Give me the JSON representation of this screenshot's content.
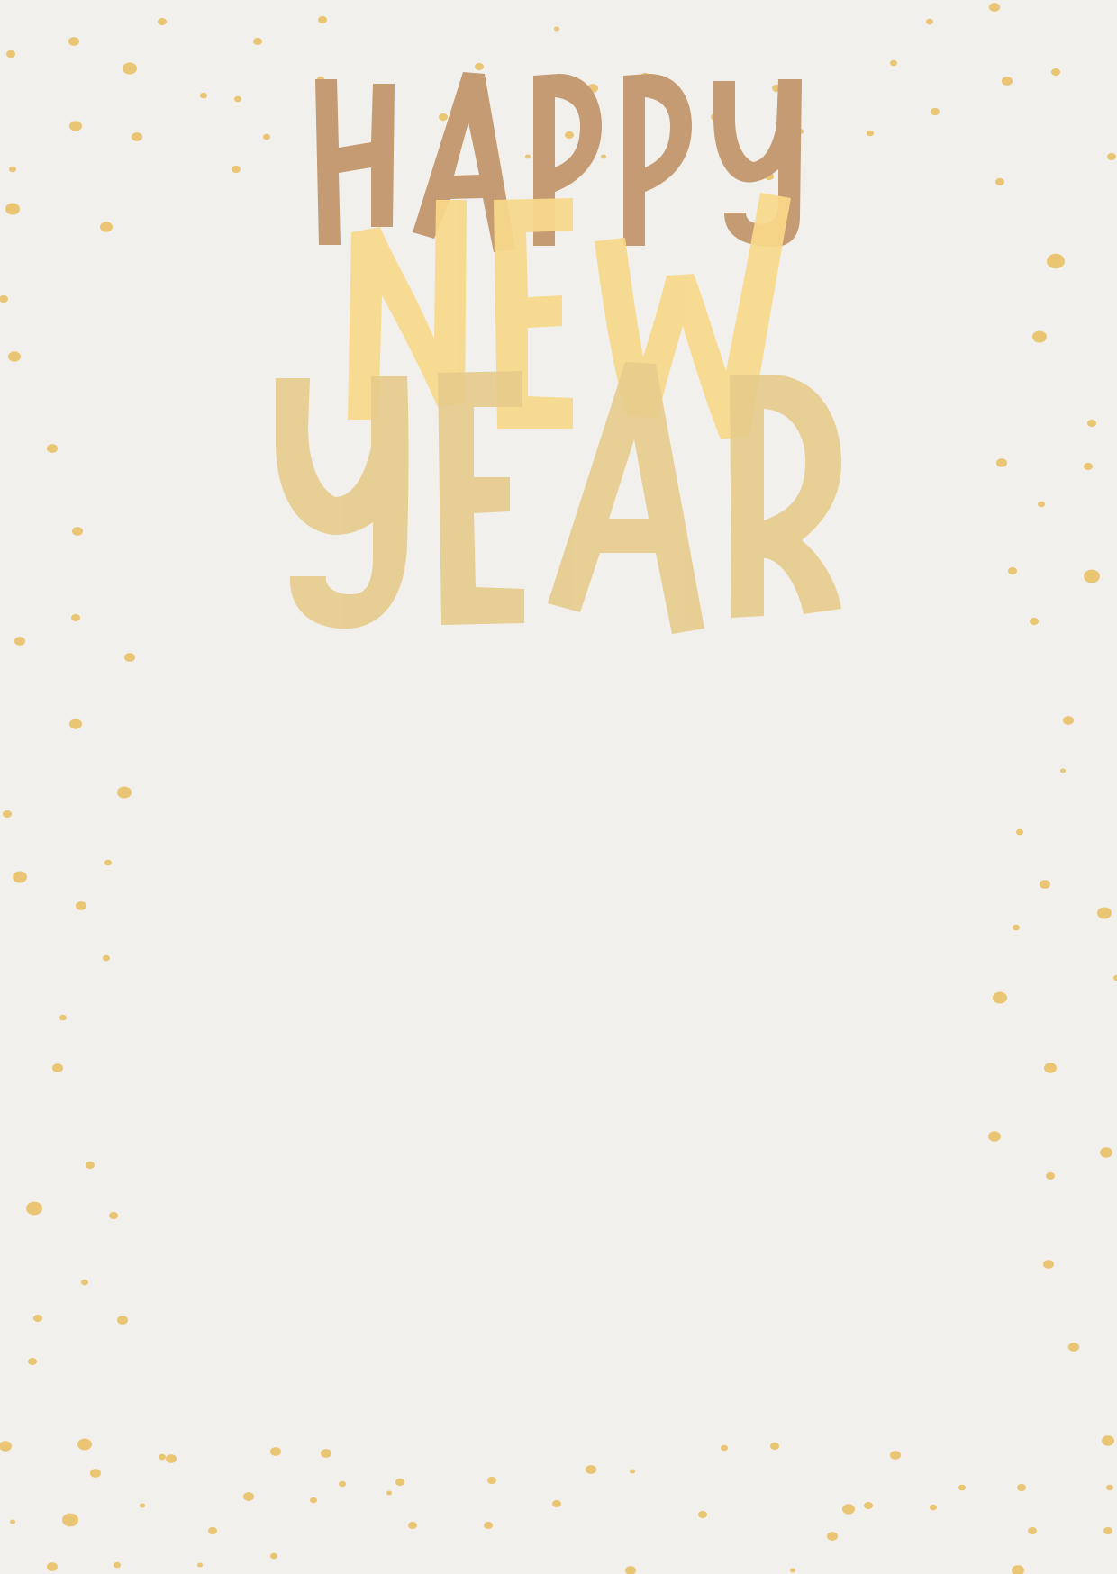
{
  "card": {
    "line1": "HAPPY",
    "line2": "NEW",
    "line3": "YEAR"
  },
  "colors": {
    "background": "#f2f0ec",
    "happy": "#c49b72",
    "new": "#f8d98a",
    "year": "#e6cb8c",
    "confetti": "#e9c574"
  }
}
